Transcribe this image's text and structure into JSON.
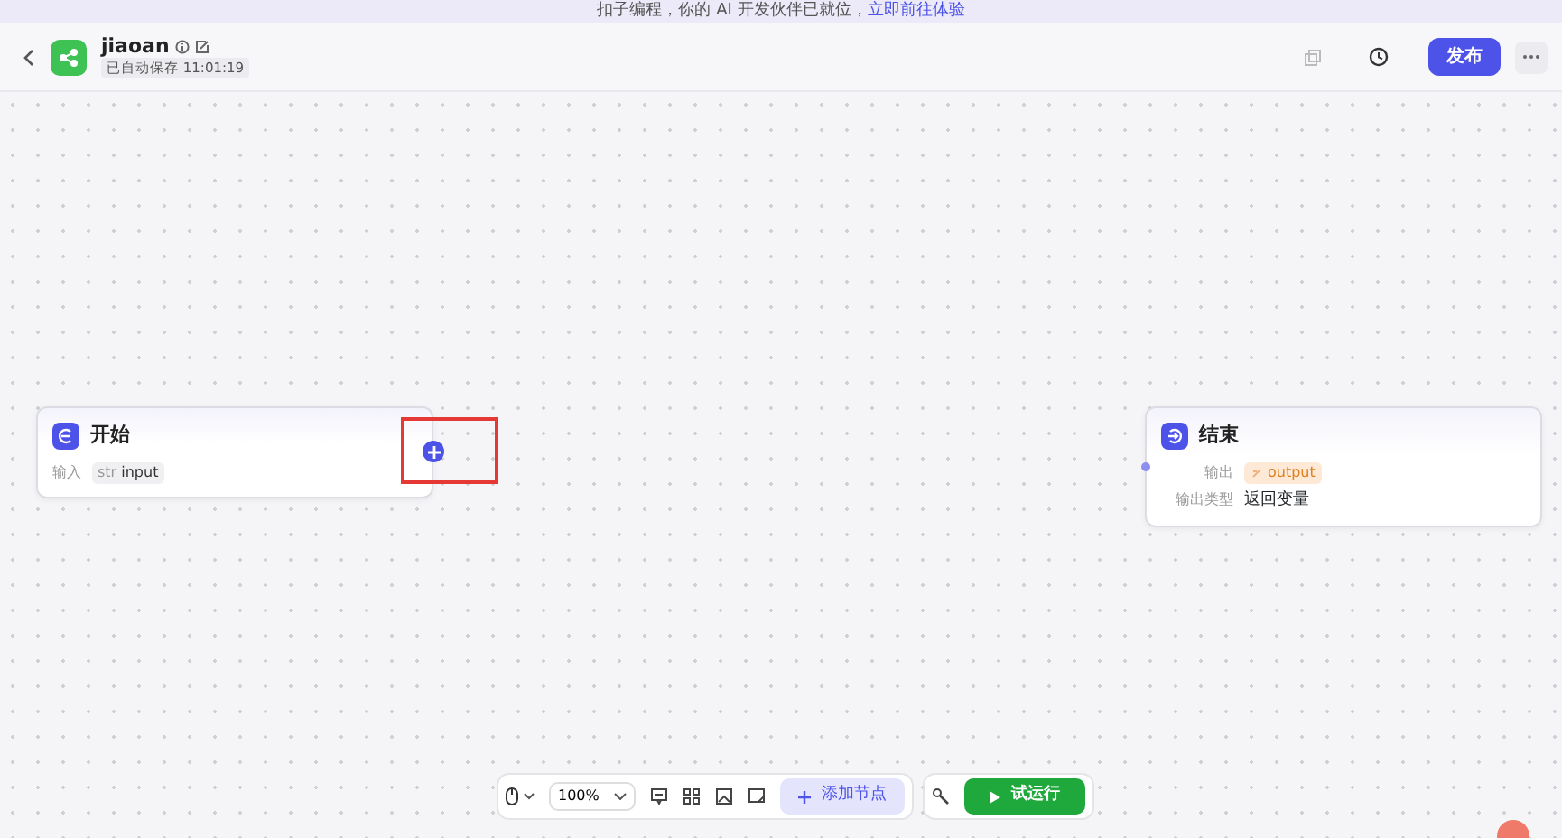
{
  "banner": {
    "text": "扣子编程，你的 AI 开发伙伴已就位，",
    "link": "立即前往体验"
  },
  "header": {
    "title": "jiaoan",
    "autosave": "已自动保存 11:01:19",
    "publish": "发布"
  },
  "nodes": [
    {
      "kind": "start",
      "title": "开始",
      "rows": [
        {
          "label": "输入",
          "type": "str",
          "value": "input"
        }
      ],
      "add_button": true,
      "highlighted": true
    },
    {
      "kind": "end",
      "title": "结束",
      "rows": [
        {
          "label": "输出",
          "value": "output"
        },
        {
          "label": "输出类型",
          "value": "返回变量"
        }
      ],
      "add_button": false,
      "highlighted": false
    }
  ],
  "toolbar": {
    "zoom": "100%",
    "add_node": "添加节点",
    "run": "试运行"
  }
}
